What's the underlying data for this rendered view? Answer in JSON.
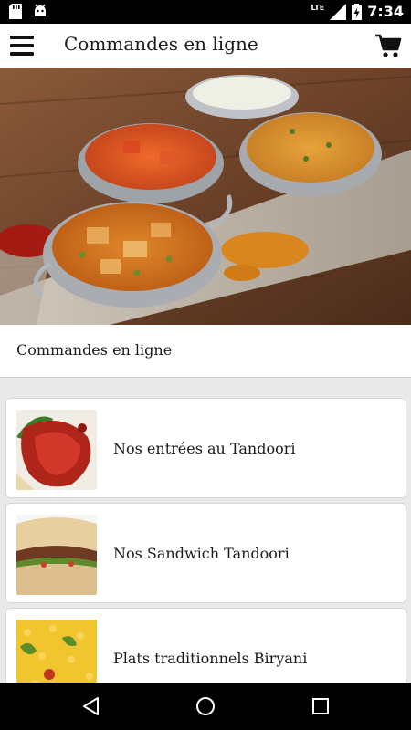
{
  "status_bar": {
    "time": "7:34",
    "network": "LTE",
    "icons": [
      "sd-card-icon",
      "android-icon",
      "signal-icon",
      "battery-charging-icon"
    ]
  },
  "app_bar": {
    "title": "Commandes en ligne",
    "menu_icon": "hamburger-menu-icon",
    "cart_icon": "shopping-cart-icon"
  },
  "hero": {
    "image": "indian-curry-dishes-photo"
  },
  "section": {
    "title": "Commandes en ligne"
  },
  "categories": [
    {
      "label": "Nos entrées au Tandoori",
      "thumb": "tandoori-chicken-photo"
    },
    {
      "label": "Nos Sandwich Tandoori",
      "thumb": "kebab-sandwich-photo"
    },
    {
      "label": "Plats traditionnels Biryani",
      "thumb": "biryani-rice-photo"
    }
  ],
  "nav_bar": {
    "icons": [
      "back-icon",
      "home-icon",
      "recents-icon"
    ]
  }
}
